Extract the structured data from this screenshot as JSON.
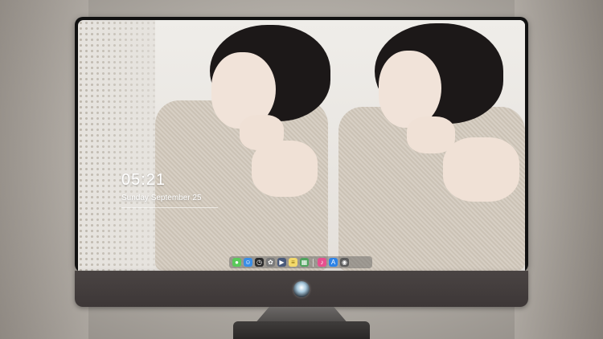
{
  "desktop": {
    "clock": {
      "time": "05:21",
      "date": "Sunday September 25"
    },
    "dock": {
      "apps": [
        {
          "name": "messages",
          "color": "#5ac95a",
          "glyph": "●"
        },
        {
          "name": "finder",
          "color": "#3a8ee6",
          "glyph": "☺"
        },
        {
          "name": "clock",
          "color": "#2b2b2b",
          "glyph": "◷"
        },
        {
          "name": "photos",
          "color": "#7a7a7a",
          "glyph": "✿"
        },
        {
          "name": "video",
          "color": "#4a5a7a",
          "glyph": "▶"
        },
        {
          "name": "notes",
          "color": "#f3d96b",
          "glyph": "≡"
        },
        {
          "name": "preview",
          "color": "#4fa35d",
          "glyph": "▦"
        },
        {
          "name": "music",
          "color": "#e64f8f",
          "glyph": "♪"
        },
        {
          "name": "app-store",
          "color": "#2d83e7",
          "glyph": "A"
        },
        {
          "name": "camera",
          "color": "#5b5b5b",
          "glyph": "◉"
        }
      ]
    }
  },
  "colors": {
    "bezel": "#111111",
    "chin": "#443e3d",
    "background": "#b6b1aa"
  }
}
